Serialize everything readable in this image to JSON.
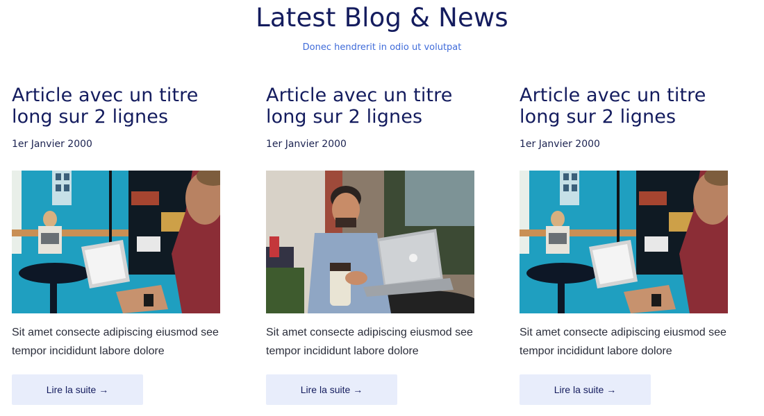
{
  "header": {
    "title": "Latest Blog & News",
    "subtitle": "Donec hendrerit in odio ut volutpat"
  },
  "cards": [
    {
      "title": "Article avec un titre long sur 2 lignes",
      "date": "1er Janvier 2000",
      "image": "photo-office-laptop",
      "text": "Sit amet consecte adipiscing eiusmod see tempor incididunt labore dolore",
      "button": "Lire la suite",
      "arrow": "→"
    },
    {
      "title": "Article avec un titre long sur 2 lignes",
      "date": "1er Janvier 2000",
      "image": "photo-man-laptop-coffee",
      "text": "Sit amet consecte adipiscing eiusmod see tempor incididunt labore dolore",
      "button": "Lire la suite",
      "arrow": "→"
    },
    {
      "title": "Article avec un titre long sur 2 lignes",
      "date": "1er Janvier 2000",
      "image": "photo-office-laptop",
      "text": "Sit amet consecte adipiscing eiusmod see tempor incididunt labore dolore",
      "button": "Lire la suite",
      "arrow": "→"
    }
  ],
  "colors": {
    "heading": "#141c5e",
    "subtitle": "#3f6bd9",
    "button_bg": "#e8edfb"
  }
}
